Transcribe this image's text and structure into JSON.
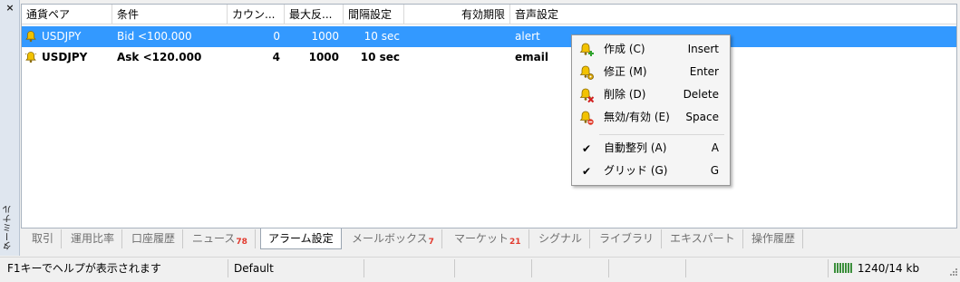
{
  "sidebar": {
    "close": "×",
    "title": "ターミナル"
  },
  "table": {
    "headers": [
      "通貨ペア",
      "条件",
      "カウン...",
      "最大反...",
      "間隔設定",
      "有効期限",
      "音声設定"
    ],
    "rows": [
      {
        "symbol": "USDJPY",
        "condition": "Bid <100.000",
        "count": "0",
        "max": "1000",
        "interval": "10 sec",
        "expiry": "",
        "sound": "alert"
      },
      {
        "symbol": "USDJPY",
        "condition": "Ask <120.000",
        "count": "4",
        "max": "1000",
        "interval": "10 sec",
        "expiry": "",
        "sound": "email"
      }
    ]
  },
  "context_menu": {
    "items": [
      {
        "label": "作成 (C)",
        "shortcut": "Insert",
        "icon": "bell-add-icon"
      },
      {
        "label": "修正 (M)",
        "shortcut": "Enter",
        "icon": "bell-edit-icon"
      },
      {
        "label": "削除 (D)",
        "shortcut": "Delete",
        "icon": "bell-delete-icon"
      },
      {
        "label": "無効/有効 (E)",
        "shortcut": "Space",
        "icon": "bell-disable-icon"
      },
      {
        "label": "自動整列 (A)",
        "shortcut": "A",
        "icon": "check-icon"
      },
      {
        "label": "グリッド (G)",
        "shortcut": "G",
        "icon": "check-icon"
      }
    ],
    "check_glyph": "✔"
  },
  "tabs": [
    {
      "label": "取引"
    },
    {
      "label": "運用比率"
    },
    {
      "label": "口座履歴"
    },
    {
      "label": "ニュース",
      "badge": "78"
    },
    {
      "label": "アラーム設定",
      "active": true
    },
    {
      "label": "メールボックス",
      "badge": "7"
    },
    {
      "label": "マーケット",
      "badge": "21"
    },
    {
      "label": "シグナル"
    },
    {
      "label": "ライブラリ"
    },
    {
      "label": "エキスパート"
    },
    {
      "label": "操作履歴"
    }
  ],
  "status": {
    "help": "F1キーでヘルプが表示されます",
    "profile": "Default",
    "traffic": "1240/14 kb"
  },
  "colors": {
    "selection": "#3399ff",
    "badge": "#e23a2e",
    "bell": "#f2c200"
  }
}
